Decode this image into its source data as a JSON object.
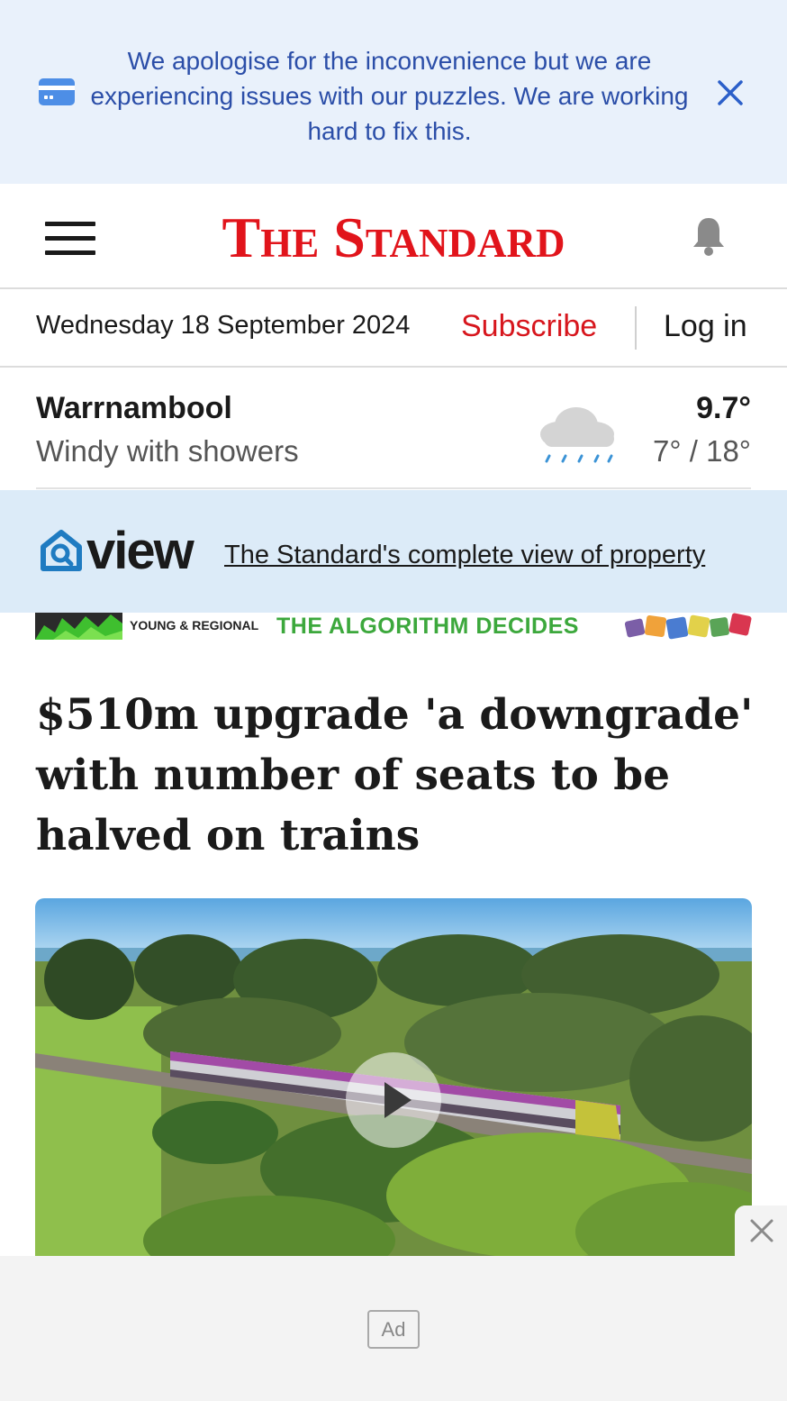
{
  "notice": {
    "message": "We apologise for the inconvenience but we are experiencing issues with our puzzles. We are working hard to fix this.",
    "icon": "credit-card-icon",
    "close_icon": "close-icon",
    "accent": "#2b4ea8",
    "background": "#e9f1fb"
  },
  "header": {
    "logo": "The Standard",
    "menu_icon": "hamburger-icon",
    "notification_icon": "bell-icon",
    "brand_color": "#e1141b"
  },
  "datebar": {
    "date": "Wednesday 18 September 2024",
    "subscribe": "Subscribe",
    "login": "Log in"
  },
  "weather": {
    "city": "Warrnambool",
    "description": "Windy with showers",
    "current": "9.7°",
    "range": "7° / 18°",
    "icon": "rain-cloud-icon"
  },
  "view_promo": {
    "brand": "view",
    "link": "The Standard's complete view of property"
  },
  "ad_strip": {
    "small_text": "YOUNG & REGIONAL",
    "big_text": "THE ALGORITHM DECIDES"
  },
  "article": {
    "headline": "$510m upgrade 'a downgrade' with number of seats to be halved on trains",
    "media_play_icon": "play-icon"
  },
  "sticky_ad": {
    "badge": "Ad",
    "close_icon": "close-icon"
  }
}
